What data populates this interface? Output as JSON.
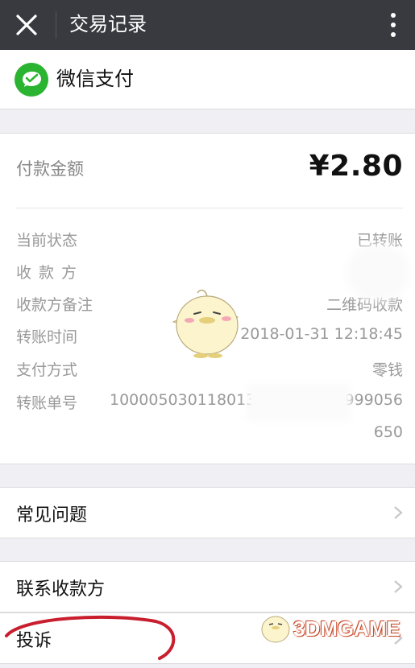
{
  "topbar": {
    "title": "交易记录",
    "close_icon": "close-icon",
    "more_icon": "more-vertical-icon"
  },
  "brand": {
    "name": "微信支付",
    "logo_icon": "wechat-pay-icon",
    "color": "#2bb431"
  },
  "payment": {
    "amount_label": "付款金额",
    "amount": "¥2.80"
  },
  "details": [
    {
      "label": "当前状态",
      "value": "已转账"
    },
    {
      "label": "收款方",
      "value": "张"
    },
    {
      "label": "收款方备注",
      "value": "二维码收款"
    },
    {
      "label": "转账时间",
      "value": "2018-01-31 12:18:45"
    },
    {
      "label": "支付方式",
      "value": "零钱"
    },
    {
      "label": "转账单号",
      "value": "1000050301180131",
      "value_tail": "9999056",
      "value_line2": "650"
    }
  ],
  "menu": [
    {
      "label": "常见问题"
    },
    {
      "label": "联系收款方"
    },
    {
      "label": "投诉"
    }
  ],
  "watermark": {
    "text": "3DMGAME"
  },
  "colors": {
    "topbar": "#393a3f",
    "background": "#efeff4",
    "annotation": "#c81e2e"
  }
}
